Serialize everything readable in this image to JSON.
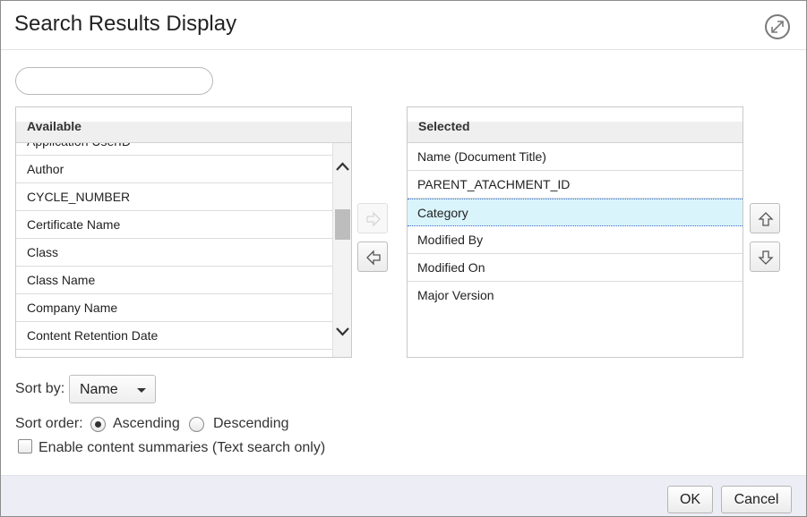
{
  "dialog": {
    "title": "Search Results Display",
    "expand_icon": "expand-diagonal-arrows-icon"
  },
  "filter": {
    "value": "",
    "placeholder": ""
  },
  "available": {
    "header": "Available",
    "items": [
      "Application UserID",
      "Author",
      "CYCLE_NUMBER",
      "Certificate Name",
      "Class",
      "Class Name",
      "Company Name",
      "Content Retention Date"
    ],
    "scroll_up_icon": "chevron-up-icon",
    "scroll_down_icon": "chevron-down-icon"
  },
  "transfer": {
    "add_icon": "arrow-right-icon",
    "add_enabled": false,
    "remove_icon": "arrow-left-icon",
    "remove_enabled": true
  },
  "selected": {
    "header": "Selected",
    "items": [
      "Name (Document Title)",
      "PARENT_ATACHMENT_ID",
      "Category",
      "Modified By",
      "Modified On",
      "Major Version"
    ],
    "highlighted": "Category",
    "move_up_icon": "arrow-up-icon",
    "move_down_icon": "arrow-down-icon"
  },
  "sort_by": {
    "label": "Sort by:",
    "value": "Name"
  },
  "sort_order": {
    "label": "Sort order:",
    "ascending": "Ascending",
    "descending": "Descending",
    "selected": "Ascending"
  },
  "summaries": {
    "label": "Enable content summaries (Text search only)",
    "checked": false
  },
  "footer": {
    "ok": "OK",
    "cancel": "Cancel"
  },
  "colors": {
    "highlight_bg": "#d9f4fb",
    "footer_bg": "#edeef5",
    "header_bg": "#efefef"
  }
}
